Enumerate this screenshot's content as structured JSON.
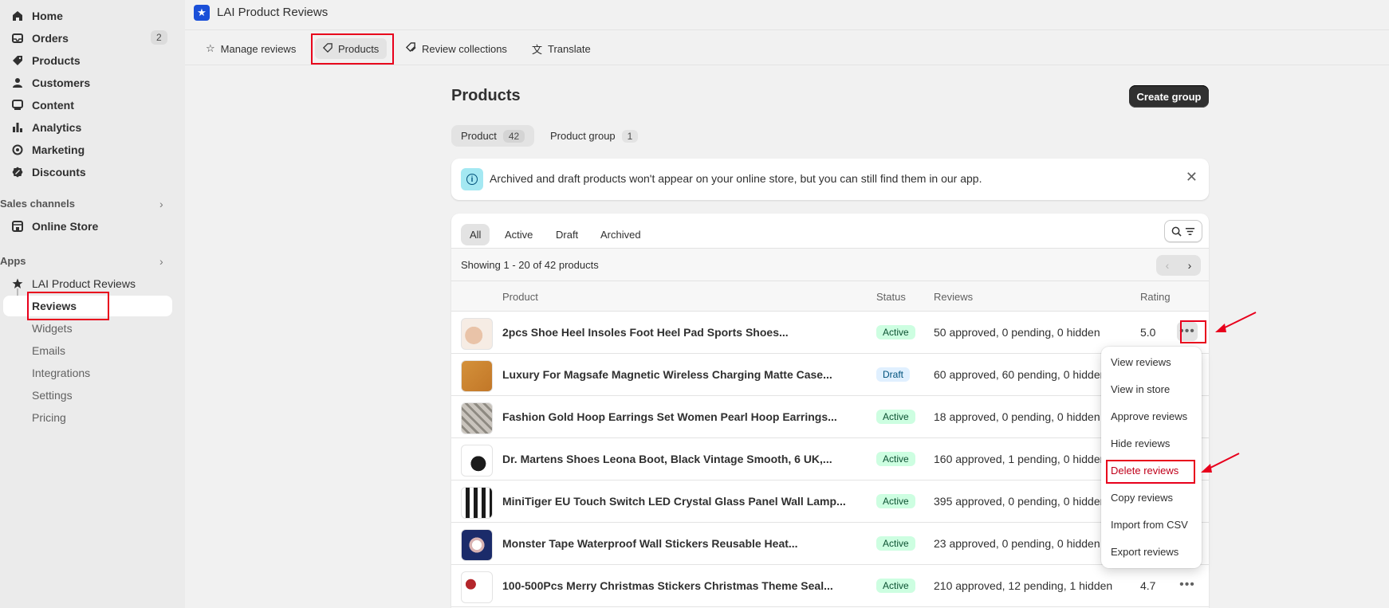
{
  "sidebar": {
    "nav": [
      {
        "label": "Home",
        "icon": "home-icon"
      },
      {
        "label": "Orders",
        "icon": "inbox-icon",
        "badge": "2"
      },
      {
        "label": "Products",
        "icon": "tag-icon"
      },
      {
        "label": "Customers",
        "icon": "person-icon"
      },
      {
        "label": "Content",
        "icon": "content-icon"
      },
      {
        "label": "Analytics",
        "icon": "bar-chart-icon"
      },
      {
        "label": "Marketing",
        "icon": "target-icon"
      },
      {
        "label": "Discounts",
        "icon": "discount-icon"
      }
    ],
    "sales_channels_title": "Sales channels",
    "online_store": "Online Store",
    "apps_title": "Apps",
    "app_name": "LAI Product Reviews",
    "app_sub": [
      "Reviews",
      "Widgets",
      "Emails",
      "Integrations",
      "Settings",
      "Pricing"
    ]
  },
  "header": {
    "app_title": "LAI Product Reviews",
    "tabs": [
      {
        "label": "Manage reviews",
        "icon": "star-icon"
      },
      {
        "label": "Products",
        "icon": "tag-icon"
      },
      {
        "label": "Review collections",
        "icon": "tags-icon"
      },
      {
        "label": "Translate",
        "icon": "translate-icon"
      }
    ]
  },
  "main": {
    "title": "Products",
    "create_group": "Create group",
    "segments": [
      {
        "label": "Product",
        "count": "42"
      },
      {
        "label": "Product group",
        "count": "1"
      }
    ],
    "banner": "Archived and draft products won't appear on your online store, but you can still find them in our app.",
    "filters": [
      "All",
      "Active",
      "Draft",
      "Archived"
    ],
    "showing": "Showing 1 - 20 of 42 products",
    "columns": {
      "product": "Product",
      "status": "Status",
      "reviews": "Reviews",
      "rating": "Rating"
    },
    "rows": [
      {
        "name": "2pcs Shoe Heel Insoles Foot Heel Pad Sports Shoes...",
        "status": "Active",
        "reviews": "50 approved, 0 pending, 0 hidden",
        "rating": "5.0"
      },
      {
        "name": "Luxury For Magsafe Magnetic Wireless Charging Matte Case...",
        "status": "Draft",
        "reviews": "60 approved, 60 pending, 0 hidden",
        "rating": ""
      },
      {
        "name": "Fashion Gold Hoop Earrings Set Women Pearl Hoop Earrings...",
        "status": "Active",
        "reviews": "18 approved, 0 pending, 0 hidden",
        "rating": ""
      },
      {
        "name": "Dr. Martens Shoes Leona Boot, Black Vintage Smooth, 6 UK,...",
        "status": "Active",
        "reviews": "160 approved, 1 pending, 0 hidden",
        "rating": ""
      },
      {
        "name": "MiniTiger EU Touch Switch LED Crystal Glass Panel Wall Lamp...",
        "status": "Active",
        "reviews": "395 approved, 0 pending, 0 hidden",
        "rating": ""
      },
      {
        "name": "Monster Tape Waterproof Wall Stickers Reusable Heat...",
        "status": "Active",
        "reviews": "23 approved, 0 pending, 0 hidden",
        "rating": ""
      },
      {
        "name": "100-500Pcs Merry Christmas Stickers Christmas Theme Seal...",
        "status": "Active",
        "reviews": "210 approved, 12 pending, 1 hidden",
        "rating": "4.7"
      }
    ],
    "menu": [
      "View reviews",
      "View in store",
      "Approve reviews",
      "Hide reviews",
      "Delete reviews",
      "Copy reviews",
      "Import from CSV",
      "Export reviews"
    ]
  },
  "colors": {
    "accent": "#303030",
    "highlight": "#e8001c",
    "danger": "#c0001a"
  }
}
